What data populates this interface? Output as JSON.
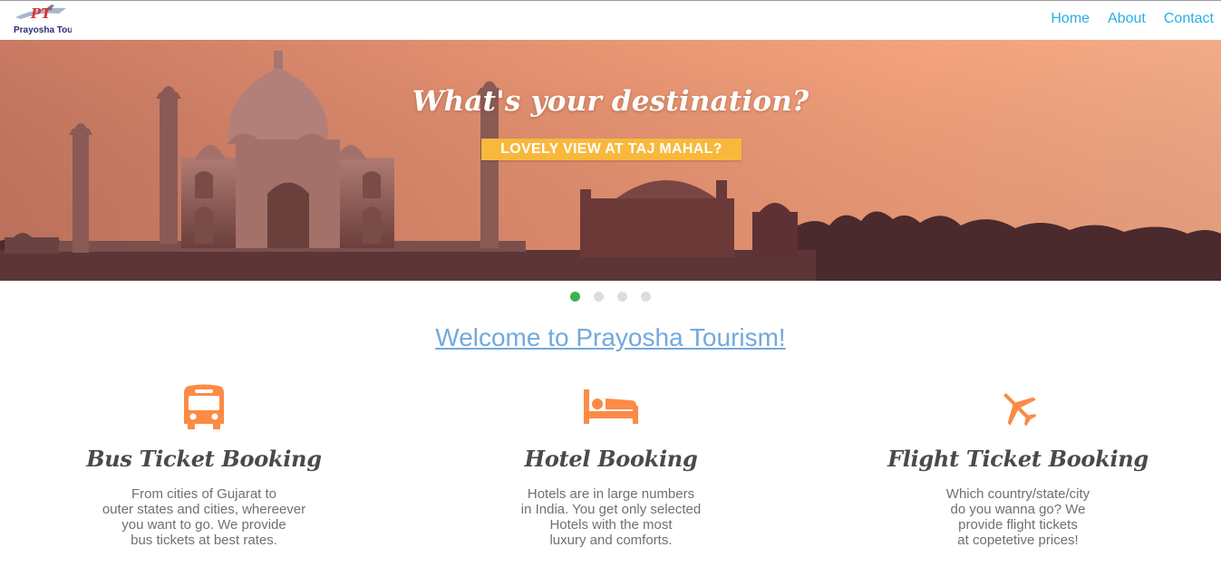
{
  "brand": {
    "logo_text": "Prayosha Tourism",
    "logo_mark": "PT"
  },
  "nav": {
    "items": [
      {
        "label": "Home"
      },
      {
        "label": "About"
      },
      {
        "label": "Contact"
      }
    ]
  },
  "hero": {
    "title": "What's your destination?",
    "cta": "LOVELY VIEW AT TAJ MAHAL?"
  },
  "carousel": {
    "slide_count": 4,
    "active_index": 0
  },
  "welcome": {
    "text": "Welcome to Prayosha Tourism!"
  },
  "features": [
    {
      "icon": "bus-icon",
      "title": "Bus Ticket Booking",
      "lines": [
        "From cities of Gujarat to",
        "outer states and cities, whereever",
        "you want to go. We provide",
        "bus tickets at best rates."
      ]
    },
    {
      "icon": "bed-icon",
      "title": "Hotel Booking",
      "lines": [
        "Hotels are in large numbers",
        "in India. You get only selected",
        "Hotels with the most",
        "luxury and comforts."
      ]
    },
    {
      "icon": "airplane-icon",
      "title": "Flight Ticket Booking",
      "lines": [
        "Which country/state/city",
        "do you wanna go? We",
        "provide flight tickets",
        "at copetetive prices!"
      ]
    }
  ],
  "colors": {
    "nav_link": "#2aaee6",
    "accent_orange": "#fb8b45",
    "cta_bg": "#f8b83b",
    "dot_active": "#3fb24a",
    "welcome_link": "#73a9dc"
  }
}
